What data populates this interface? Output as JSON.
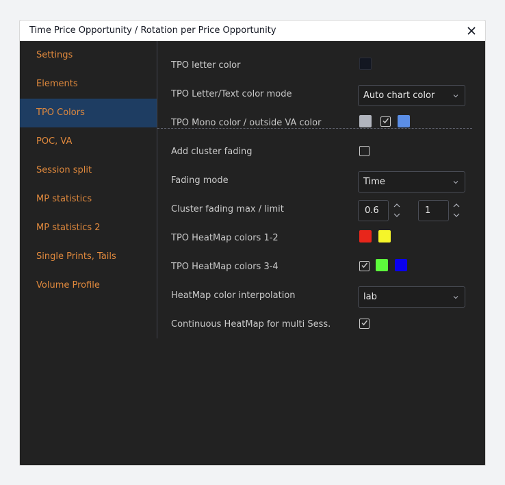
{
  "dialog": {
    "title": "Time Price Opportunity / Rotation per Price Opportunity",
    "close_icon": "close-icon"
  },
  "sidebar": {
    "items": [
      {
        "label": "Settings"
      },
      {
        "label": "Elements"
      },
      {
        "label": "TPO Colors",
        "active": true
      },
      {
        "label": "POC, VA"
      },
      {
        "label": "Session split"
      },
      {
        "label": "MP statistics"
      },
      {
        "label": "MP statistics 2"
      },
      {
        "label": "Single Prints, Tails"
      },
      {
        "label": "Volume Profile"
      }
    ]
  },
  "settings": {
    "tpo_letter_color": {
      "label": "TPO letter color",
      "color": "#131722"
    },
    "text_color_mode": {
      "label": "TPO Letter/Text color mode",
      "value": "Auto chart color"
    },
    "mono_color": {
      "label": "TPO Mono color / outside VA color",
      "color1": "#b2b5be",
      "checked": true,
      "color2": "#5b8ee6"
    },
    "cluster_fading": {
      "label": "Add cluster fading",
      "checked": false
    },
    "fading_mode": {
      "label": "Fading mode",
      "value": "Time"
    },
    "fading_max": {
      "label": "Cluster fading max / limit",
      "max": "0.6",
      "limit": "1"
    },
    "heatmap_12": {
      "label": "TPO HeatMap colors 1-2",
      "color1": "#e8261b",
      "color2": "#f5f52a"
    },
    "heatmap_34": {
      "label": "TPO HeatMap colors 3-4",
      "checked": true,
      "color1": "#5dfb3c",
      "color2": "#0a00ef"
    },
    "interpolation": {
      "label": "HeatMap color interpolation",
      "value": "lab"
    },
    "continuous": {
      "label": "Continuous HeatMap for multi Sess.",
      "checked": true
    }
  }
}
